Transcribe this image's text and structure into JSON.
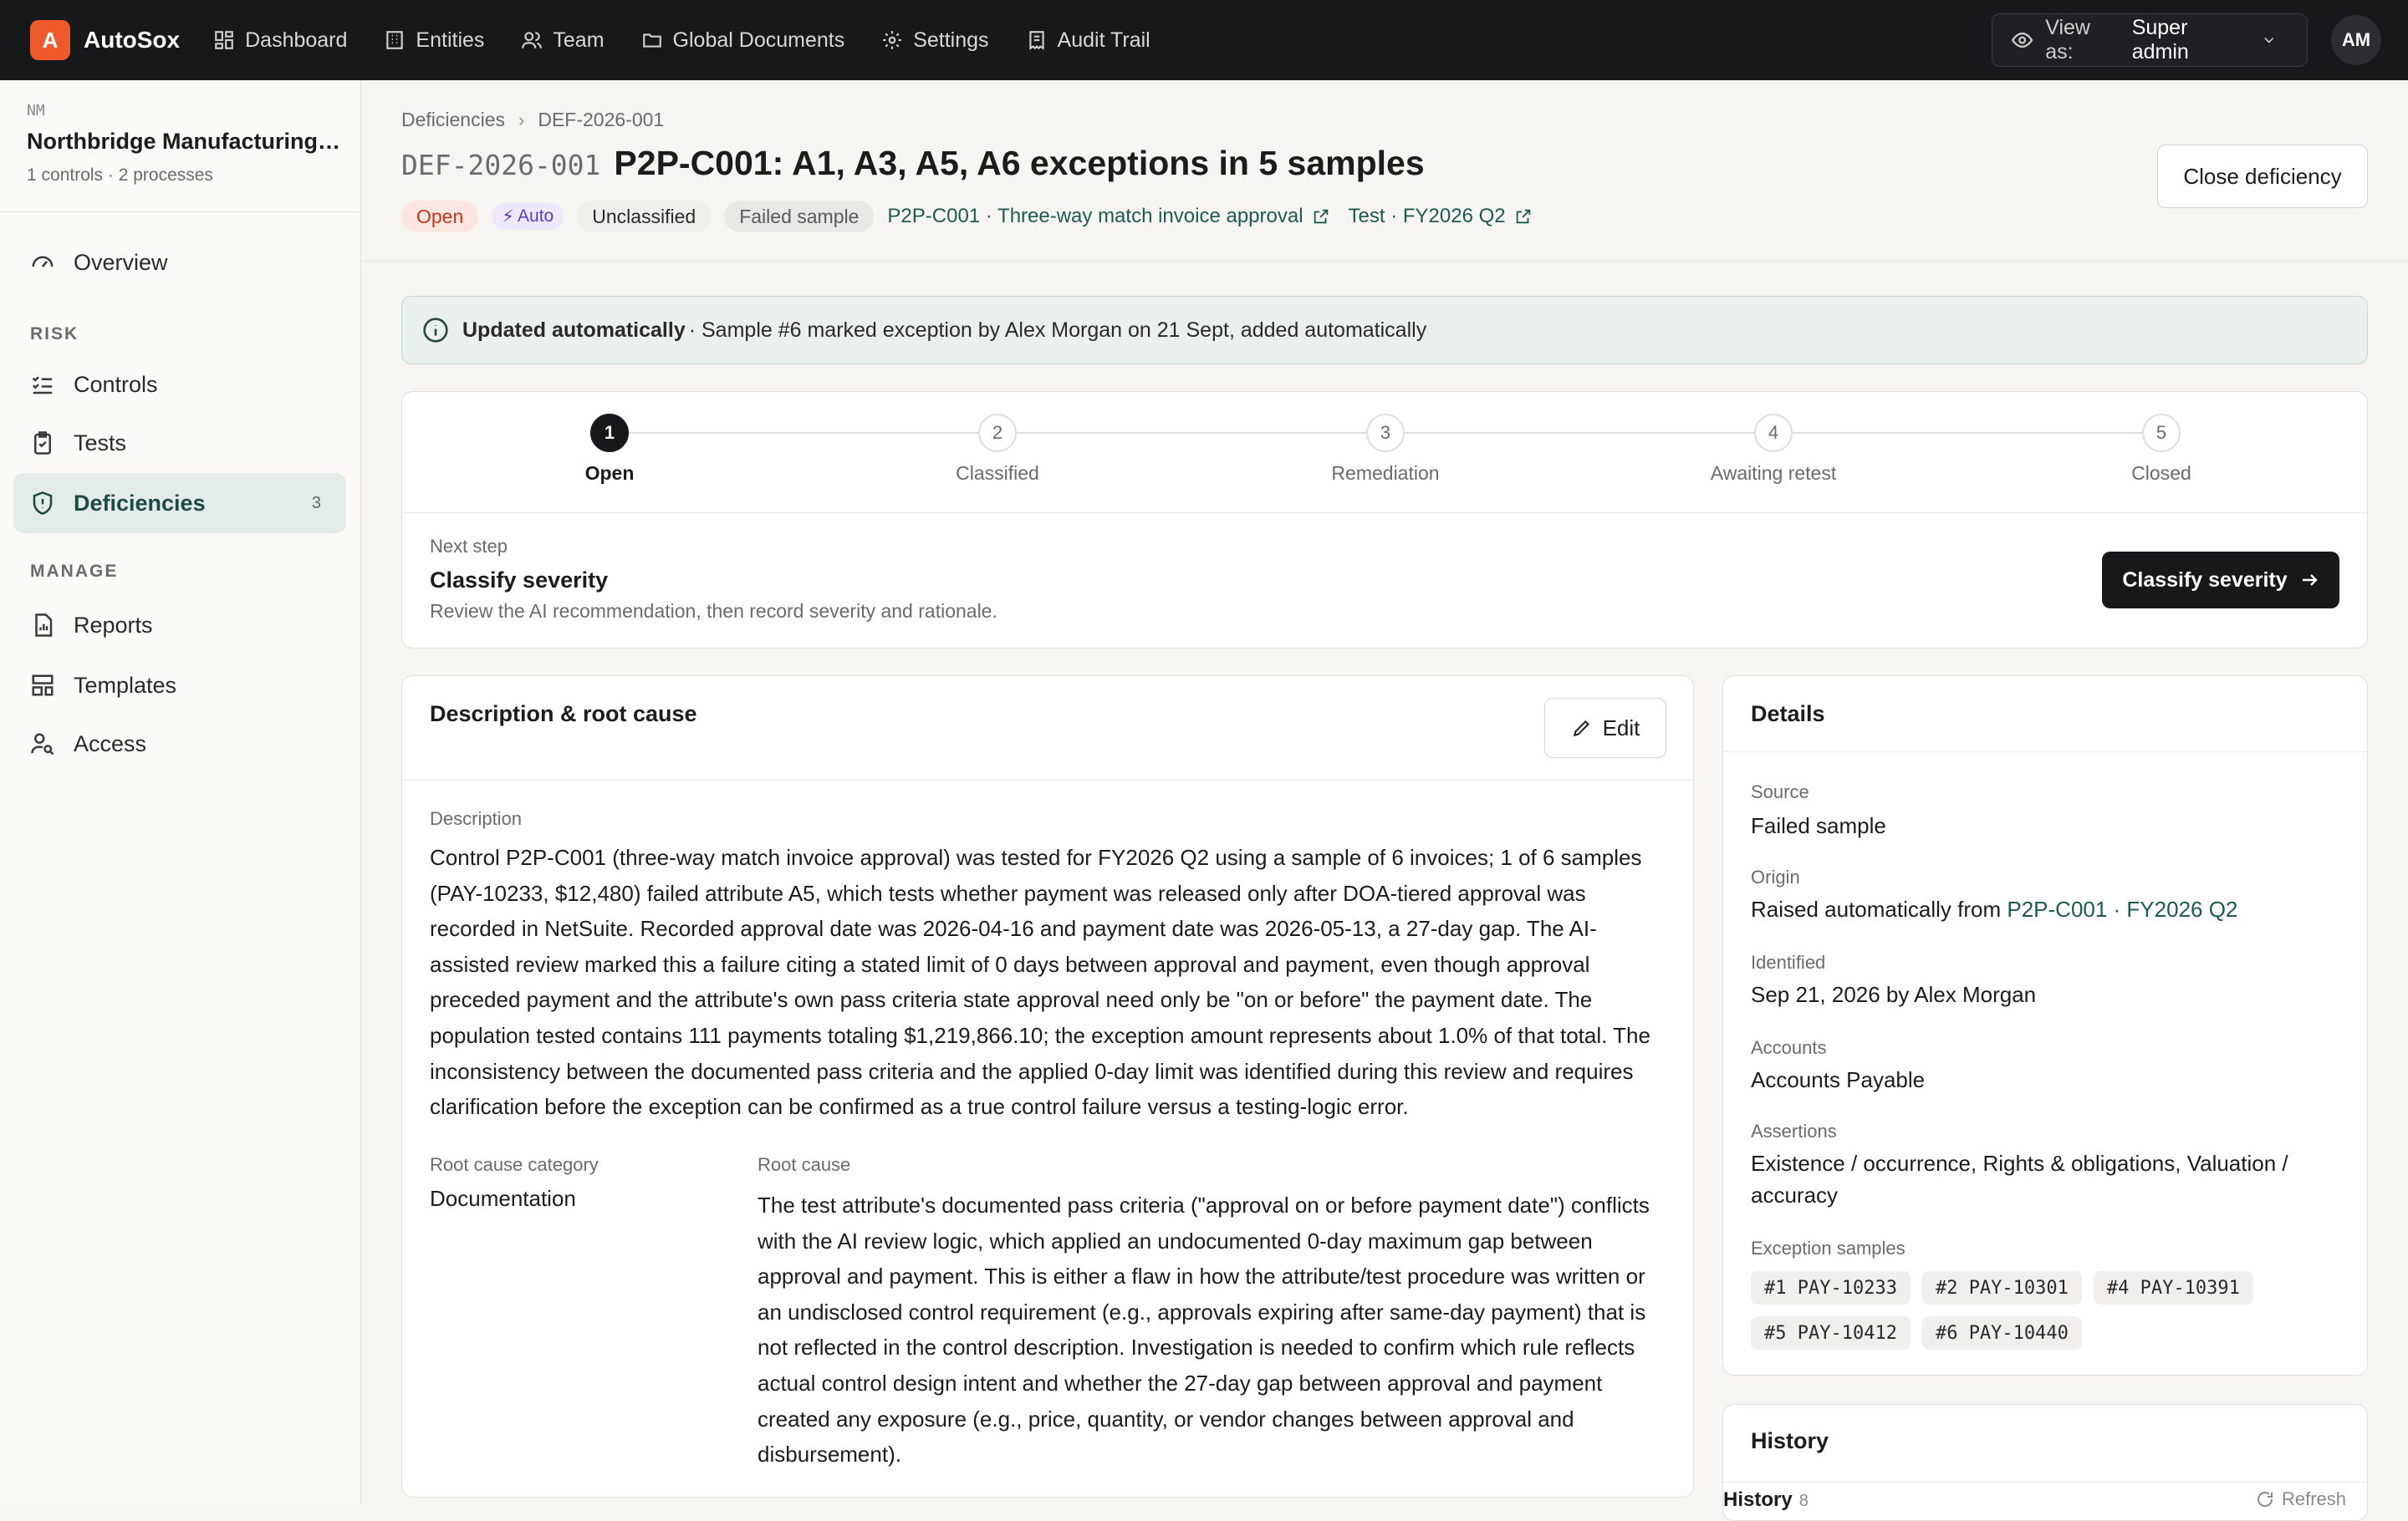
{
  "app": {
    "logo_letter": "A",
    "name": "AutoSox"
  },
  "topnav": [
    {
      "label": "Dashboard",
      "icon": "dashboard-icon"
    },
    {
      "label": "Entities",
      "icon": "building-icon"
    },
    {
      "label": "Team",
      "icon": "users-icon"
    },
    {
      "label": "Global Documents",
      "icon": "folder-icon"
    },
    {
      "label": "Settings",
      "icon": "gear-icon"
    },
    {
      "label": "Audit Trail",
      "icon": "receipt-icon"
    }
  ],
  "view_as": {
    "label": "View as:",
    "value": "Super admin"
  },
  "user": {
    "initials": "AM"
  },
  "org": {
    "abbr": "NM",
    "name": "Northbridge Manufacturing Co.",
    "meta": "1 controls · 2 processes"
  },
  "sidebar": {
    "overview": "Overview",
    "risk_section": "RISK",
    "controls": "Controls",
    "tests": "Tests",
    "deficiencies": "Deficiencies",
    "deficiencies_count": "3",
    "manage_section": "MANAGE",
    "reports": "Reports",
    "templates": "Templates",
    "access": "Access"
  },
  "breadcrumb": {
    "parent": "Deficiencies",
    "current": "DEF-2026-001"
  },
  "deficiency": {
    "id": "DEF-2026-001",
    "title": "P2P-C001: A1, A3, A5, A6 exceptions in 5 samples",
    "close_label": "Close deficiency",
    "status": "Open",
    "auto": "Auto",
    "classification": "Unclassified",
    "source_chip": "Failed sample",
    "control_link": "P2P-C001 · Three-way match invoice approval",
    "test_link": "Test · FY2026 Q2"
  },
  "banner": {
    "bold": "Updated automatically",
    "text": "· Sample #6 marked exception by Alex Morgan on 21 Sept, added automatically"
  },
  "stepper": {
    "current": 1,
    "steps": [
      {
        "num": "1",
        "label": "Open"
      },
      {
        "num": "2",
        "label": "Classified"
      },
      {
        "num": "3",
        "label": "Remediation"
      },
      {
        "num": "4",
        "label": "Awaiting retest"
      },
      {
        "num": "5",
        "label": "Closed"
      }
    ],
    "next_label": "Next step",
    "next_title": "Classify severity",
    "next_desc": "Review the AI recommendation, then record severity and rationale.",
    "action": "Classify severity"
  },
  "description": {
    "card_title": "Description & root cause",
    "edit": "Edit",
    "desc_label": "Description",
    "desc_text": "Control P2P-C001 (three-way match invoice approval) was tested for FY2026 Q2 using a sample of 6 invoices; 1 of 6 samples (PAY-10233, $12,480) failed attribute A5, which tests whether payment was released only after DOA-tiered approval was recorded in NetSuite. Recorded approval date was 2026-04-16 and payment date was 2026-05-13, a 27-day gap. The AI-assisted review marked this a failure citing a stated limit of 0 days between approval and payment, even though approval preceded payment and the attribute's own pass criteria state approval need only be \"on or before\" the payment date. The population tested contains 111 payments totaling $1,219,866.10; the exception amount represents about 1.0% of that total. The inconsistency between the documented pass criteria and the applied 0-day limit was identified during this review and requires clarification before the exception can be confirmed as a true control failure versus a testing-logic error.",
    "rc_category_label": "Root cause category",
    "rc_category": "Documentation",
    "root_label": "Root cause",
    "root_text": "The test attribute's documented pass criteria (\"approval on or before payment date\") conflicts with the AI review logic, which applied an undocumented 0-day maximum gap between approval and payment. This is either a flaw in how the attribute/test procedure was written or an undisclosed control requirement (e.g., approvals expiring after same-day payment) that is not reflected in the control description. Investigation is needed to confirm which rule reflects actual control design intent and whether the 27-day gap between approval and payment created any exposure (e.g., price, quantity, or vendor changes between approval and disbursement)."
  },
  "details": {
    "title": "Details",
    "source_label": "Source",
    "source": "Failed sample",
    "origin_label": "Origin",
    "origin_prefix": "Raised automatically from",
    "origin_link": "P2P-C001 · FY2026 Q2",
    "identified_label": "Identified",
    "identified": "Sep 21, 2026 by Alex Morgan",
    "accounts_label": "Accounts",
    "accounts": "Accounts Payable",
    "assertions_label": "Assertions",
    "assertions": "Existence / occurrence, Rights & obligations, Valuation / accuracy",
    "samples_label": "Exception samples",
    "samples": [
      "#1 PAY-10233",
      "#2 PAY-10301",
      "#4 PAY-10391",
      "#5 PAY-10412",
      "#6 PAY-10440"
    ]
  },
  "history": {
    "title": "History",
    "sub": "History",
    "count": "8",
    "refresh": "Refresh"
  },
  "colors": {
    "topbar": "#17181a",
    "brand": "#ef5a2c",
    "accent": "#1e5a52",
    "active_nav_bg": "#e3ece9",
    "status_open": "#c2361e"
  }
}
